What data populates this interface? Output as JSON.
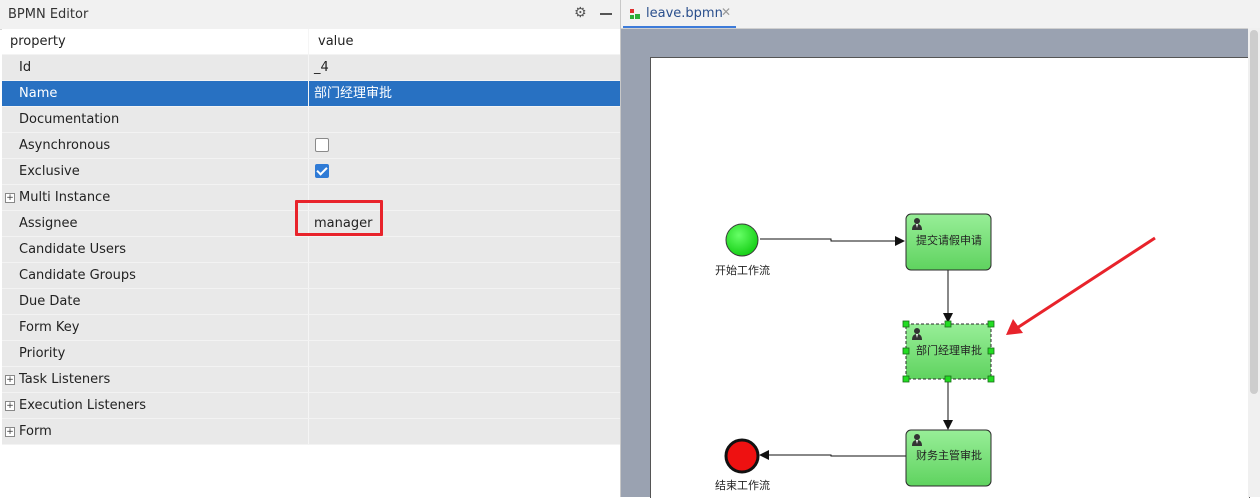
{
  "left_panel": {
    "title": "BPMN Editor",
    "columns": {
      "property": "property",
      "value": "value"
    },
    "rows": [
      {
        "name": "Id",
        "value": "_4",
        "expandable": false
      },
      {
        "name": "Name",
        "value": "部门经理审批",
        "expandable": false,
        "selected": true
      },
      {
        "name": "Documentation",
        "value": "",
        "expandable": false
      },
      {
        "name": "Asynchronous",
        "value": "",
        "expandable": false,
        "checkbox": false
      },
      {
        "name": "Exclusive",
        "value": "",
        "expandable": false,
        "checkbox": true
      },
      {
        "name": "Multi Instance",
        "value": "",
        "expandable": true
      },
      {
        "name": "Assignee",
        "value": "manager",
        "expandable": false,
        "highlighted": true
      },
      {
        "name": "Candidate Users",
        "value": "",
        "expandable": false
      },
      {
        "name": "Candidate Groups",
        "value": "",
        "expandable": false
      },
      {
        "name": "Due Date",
        "value": "",
        "expandable": false
      },
      {
        "name": "Form Key",
        "value": "",
        "expandable": false
      },
      {
        "name": "Priority",
        "value": "",
        "expandable": false
      },
      {
        "name": "Task Listeners",
        "value": "",
        "expandable": true
      },
      {
        "name": "Execution Listeners",
        "value": "",
        "expandable": true
      },
      {
        "name": "Form",
        "value": "",
        "expandable": true
      }
    ],
    "expander_glyph": "+"
  },
  "editor": {
    "tab_label": "leave.bpmn",
    "tab_close": "✕"
  },
  "diagram": {
    "start_event_label": "开始工作流",
    "end_event_label": "结束工作流",
    "tasks": [
      {
        "label": "提交请假申请"
      },
      {
        "label": "部门经理审批",
        "selected": true
      },
      {
        "label": "财务主管审批"
      }
    ]
  },
  "colors": {
    "selection": "#2871c2",
    "highlight_box": "#e8232b",
    "annotation_arrow": "#e8232b",
    "start_event": "#22dd22",
    "end_event": "#ee1111",
    "task_fill": "#7ee27e",
    "canvas_bg": "#9aa2b1"
  }
}
